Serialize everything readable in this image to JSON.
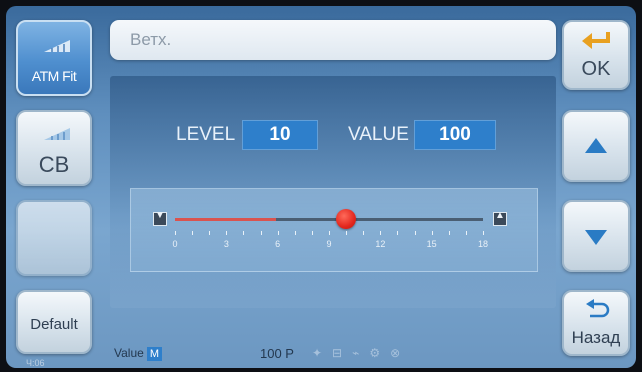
{
  "left_buttons": {
    "atm_fit": {
      "label": "ATM Fit",
      "icon": "ruler-icon"
    },
    "cb": {
      "label": "CB",
      "icon": "ruler-icon"
    },
    "blank": {
      "label": ""
    },
    "default": {
      "label": "Default"
    }
  },
  "title_bar": {
    "text": "Ветх."
  },
  "settings": {
    "level_label": "LEVEL",
    "level_value": "10",
    "value_label": "VALUE",
    "value_value": "100"
  },
  "slider": {
    "min": 0,
    "max": 18,
    "current": 10,
    "tick_labels": [
      "0",
      "3",
      "6",
      "9",
      "12",
      "15",
      "18"
    ],
    "fill_color": "#d9534f",
    "thumb_color": "#e3271e"
  },
  "right_buttons": {
    "ok": {
      "label": "OK",
      "icon": "enter-arrow-icon"
    },
    "up": {
      "icon": "arrow-up-icon"
    },
    "down": {
      "icon": "arrow-down-icon"
    },
    "back": {
      "label": "Назад",
      "icon": "back-arrow-icon"
    }
  },
  "status_bar": {
    "value_label": "Value",
    "mode_badge": "M",
    "reading": "100 P",
    "corner_text": "Ч:06"
  },
  "colors": {
    "accent": "#2e7fcb",
    "background": "#5f8fbe"
  }
}
